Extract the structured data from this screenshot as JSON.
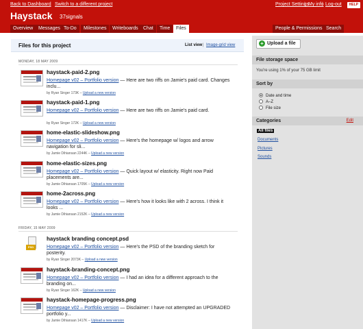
{
  "topbar": {
    "back": "Back to Dashboard",
    "sep": "|",
    "switch": "Switch to a different project",
    "settings": "Project Settings",
    "sep2": "|",
    "myinfo": "My info",
    "sep3": "|",
    "logout": "Log-out",
    "help": "HELP"
  },
  "header": {
    "title": "Haystack",
    "subtitle": "37signals"
  },
  "tabs": {
    "overview": "Overview",
    "messages": "Messages",
    "todo": "To-Do",
    "milestones": "Milestones",
    "writeboards": "Writeboards",
    "chat": "Chat",
    "time": "Time",
    "files": "Files",
    "people": "People & Permissions",
    "search": "Search"
  },
  "main": {
    "title": "Files for this project",
    "view_list": "List view",
    "view_sep": "|",
    "view_grid": "Image-grid view",
    "groups": [
      {
        "date": "Monday, 18 May 2009"
      },
      {
        "date": "Friday, 15 May 2009"
      }
    ],
    "files": [
      {
        "name": "haystack-paid-2.png",
        "link": "Homepage v02 – Portfolio version",
        "desc": " — Here are two riffs on Jamie's paid card. Changes inclu...",
        "meta": "by Ryan Singer 173K – ",
        "upload": "Upload a new version"
      },
      {
        "name": "haystack-paid-1.png",
        "link": "Homepage v02 – Portfolio version",
        "desc": " — Here are two riffs on Jamie's paid card.",
        "meta": "by Ryan Singer 172K – ",
        "upload": "Upload a new version"
      },
      {
        "name": "home-elastic-slideshow.png",
        "link": "Homepage v02 – Portfolio version",
        "desc": " — Here's the homepage w/ logos and arrow navigation for sli...",
        "meta": "by Jamie Dihiansan 2244K – ",
        "upload": "Upload a new version"
      },
      {
        "name": "home-elastic-sizes.png",
        "link": "Homepage v02 – Portfolio version",
        "desc": " — Quick layout w/ elasticity. Right now Paid placements are...",
        "meta": "by Jamie Dihiansan 1705K – ",
        "upload": "Upload a new version"
      },
      {
        "name": "home-2across.png",
        "link": "Homepage v02 – Portfolio version",
        "desc": " — Here's how it looks like with 2 across. I think it looks ...",
        "meta": "by Jamie Dihiansan 2152K – ",
        "upload": "Upload a new version"
      },
      {
        "name": "haystack branding concept.psd",
        "link": "Homepage v02 – Portfolio version",
        "desc": " — Here's the PSD of the branding sketch for posterity.",
        "meta": "by Ryan Singer 2073K – ",
        "upload": "Upload a new version",
        "psd_label": "PSD"
      },
      {
        "name": "haystack-branding-concept.png",
        "link": "Homepage v02 – Portfolio version",
        "desc": " — I had an idea for a different approach to the branding on...",
        "meta": "by Ryan Singer 162K – ",
        "upload": "Upload a new version"
      },
      {
        "name": "haystack-homepage-progress.png",
        "link": "Homepage v02 – Portfolio version",
        "desc": " — Disclaimer: I have not attempted an UPGRADED portfolio y...",
        "meta": "by Jamie Dihiansan 1417K – ",
        "upload": "Upload a new version"
      }
    ]
  },
  "sidebar": {
    "upload_plus": "+",
    "upload_label": "Upload a file",
    "storage_title": "File storage space",
    "storage_text": "You're using 1% of your 75 GB limit",
    "sort_title": "Sort by",
    "sort_options": [
      "Date and time",
      "A–Z",
      "File size"
    ],
    "sort_selected": "Date and time",
    "categories_title": "Categories",
    "categories_edit": "Edit",
    "categories": [
      "All files",
      "Documents",
      "Pictures",
      "Sounds"
    ],
    "category_selected": "All files"
  },
  "colors": {
    "brand_red": "#c2110a",
    "tab_dark": "#8e0c07",
    "link_blue": "#1e4fa0",
    "sidebar_bg": "#e2e2e2"
  }
}
